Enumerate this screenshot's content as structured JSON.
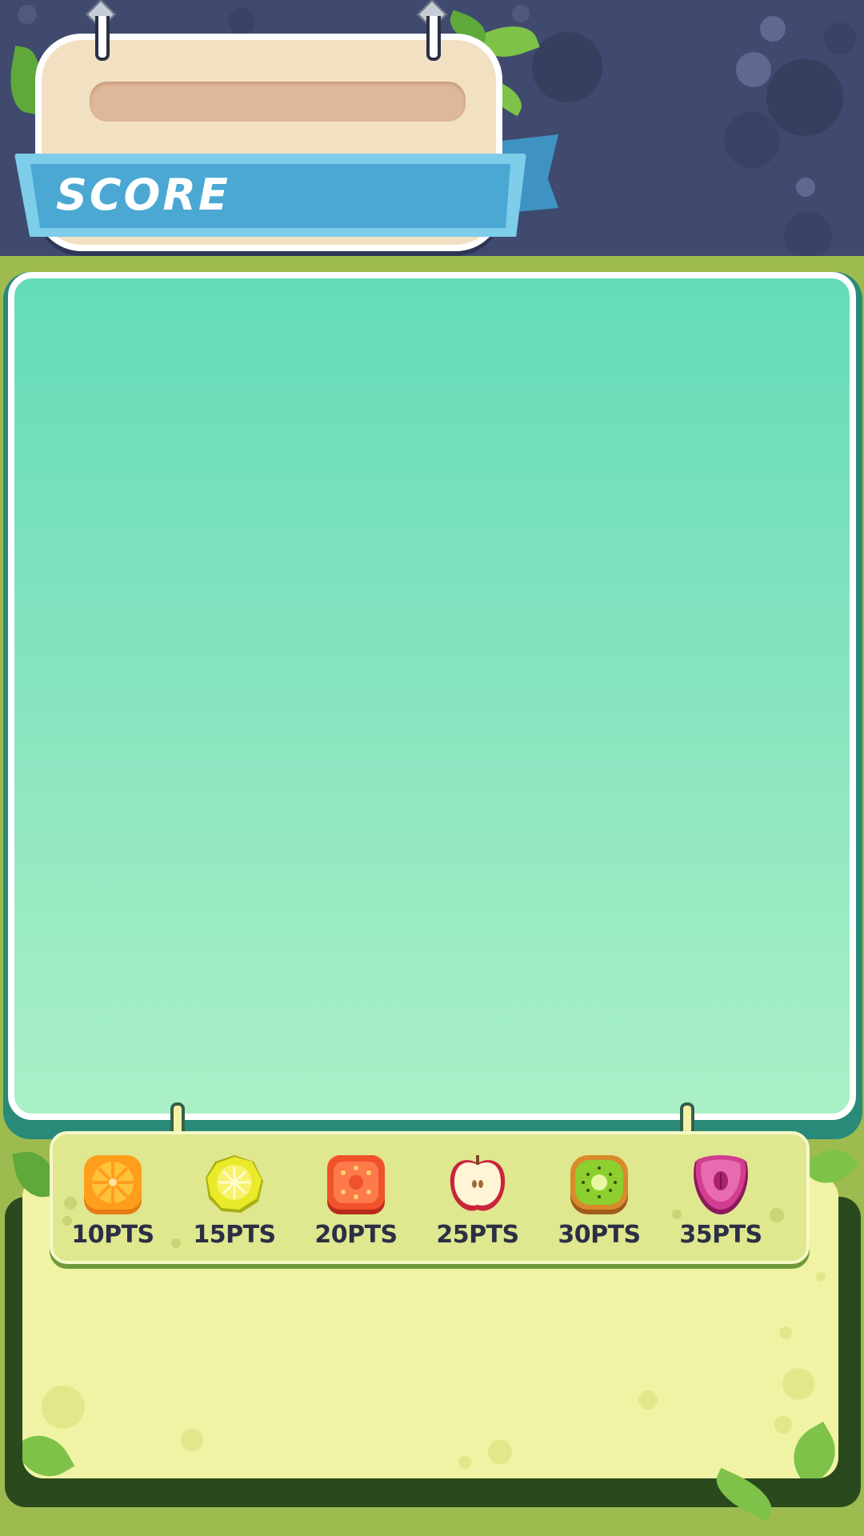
{
  "score_panel": {
    "title": "SCORE",
    "value": ""
  },
  "fruits": [
    {
      "name": "orange",
      "points_label": "10PTS",
      "color": "#ff9d1c"
    },
    {
      "name": "lemon",
      "points_label": "15PTS",
      "color": "#e9ea2a"
    },
    {
      "name": "tomato",
      "points_label": "20PTS",
      "color": "#f0522b"
    },
    {
      "name": "apple",
      "points_label": "25PTS",
      "color": "#e03a4c"
    },
    {
      "name": "kiwi",
      "points_label": "30PTS",
      "color": "#8ccf2e"
    },
    {
      "name": "raspberry",
      "points_label": "35PTS",
      "color": "#d23d91"
    }
  ],
  "colors": {
    "header_bg": "#3f4a6e",
    "ribbon": "#4aa8d3",
    "board": "#f1e1c2",
    "play_area_top": "#64dbb9",
    "play_area_bottom": "#aaf0c6",
    "lower_panel": "#f0f3a4",
    "background": "#9ebb4f"
  }
}
